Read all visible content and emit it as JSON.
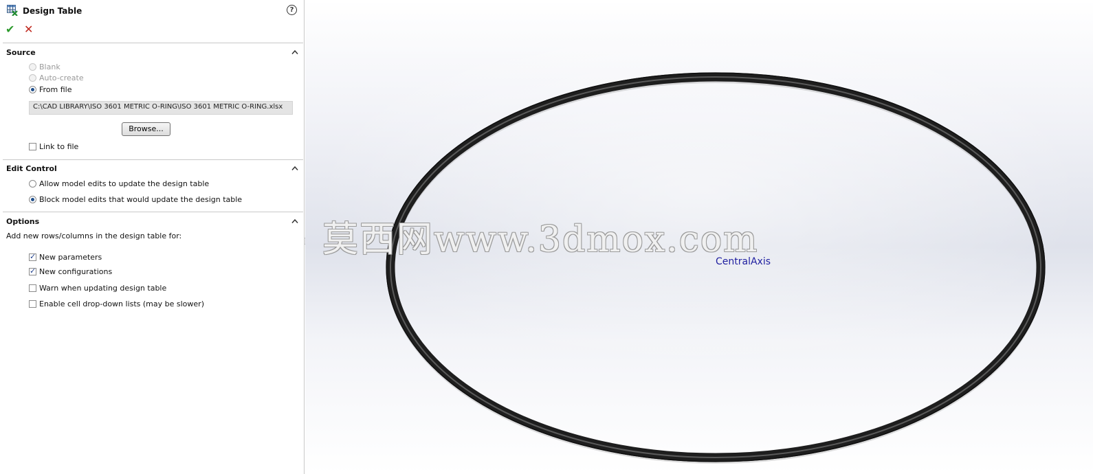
{
  "panel": {
    "title": "Design Table",
    "help_label": "?",
    "ok_symbol": "✔",
    "cancel_symbol": "✕"
  },
  "source": {
    "title": "Source",
    "blank_label": "Blank",
    "autocreate_label": "Auto-create",
    "fromfile_label": "From file",
    "selected": "From file",
    "file_path": "C:\\CAD LIBRARY\\ISO 3601 METRIC O-RING\\ISO 3601 METRIC O-RING.xlsx",
    "browse_label": "Browse...",
    "link_label": "Link to file",
    "link_checked": false
  },
  "edit_control": {
    "title": "Edit Control",
    "allow_label": "Allow model edits to update the design table",
    "block_label": "Block model edits that would update the design table",
    "selected": "block"
  },
  "options": {
    "title": "Options",
    "description": "Add new rows/columns in the design table for:",
    "items": [
      {
        "label": "New parameters",
        "checked": true
      },
      {
        "label": "New configurations",
        "checked": true
      },
      {
        "label": "Warn when updating design table",
        "checked": false
      },
      {
        "label": "Enable cell drop-down lists (may be slower)",
        "checked": false
      }
    ]
  },
  "viewport": {
    "axis_label": "CentralAxis",
    "watermark": "莫西网www.3dmox.com",
    "ring_color": "#1e1e1e"
  }
}
